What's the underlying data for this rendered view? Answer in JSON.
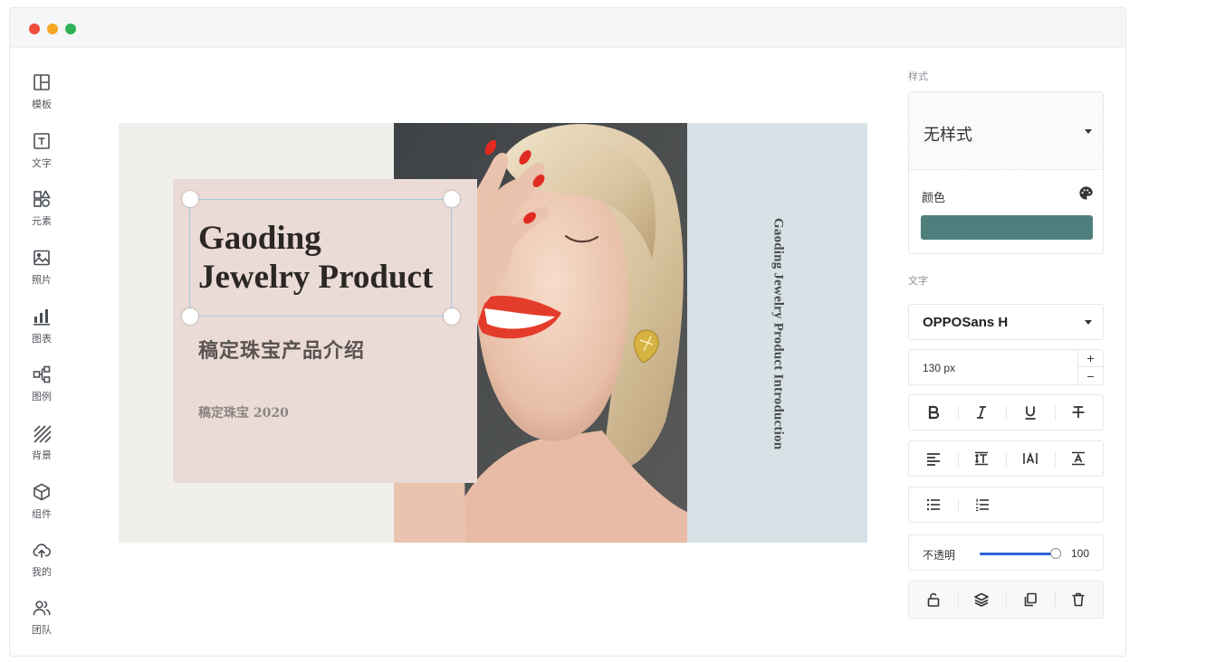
{
  "sidebar": {
    "items": [
      {
        "label": "模板",
        "icon": "layout-icon"
      },
      {
        "label": "文字",
        "icon": "text-icon"
      },
      {
        "label": "元素",
        "icon": "shapes-icon"
      },
      {
        "label": "照片",
        "icon": "image-icon"
      },
      {
        "label": "图表",
        "icon": "bar-chart-icon"
      },
      {
        "label": "图例",
        "icon": "diagram-icon"
      },
      {
        "label": "背景",
        "icon": "stripes-icon"
      },
      {
        "label": "组件",
        "icon": "cube-icon"
      },
      {
        "label": "我的",
        "icon": "cloud-upload-icon"
      },
      {
        "label": "团队",
        "icon": "team-icon"
      }
    ]
  },
  "slide": {
    "title_line1": "Gaoding",
    "title_line2": "Jewelry Product",
    "subtitle": "稿定珠宝产品介绍",
    "caption": "稿定珠宝 2020",
    "vertical_text": "Gaoding Jewelry Product Introduction",
    "colors": {
      "background": "#f0efeb",
      "pink_box": "#eadbd6",
      "blue_panel": "#d7e2e7"
    }
  },
  "panel": {
    "style_label": "样式",
    "style_value": "无样式",
    "color_label": "颜色",
    "color_value": "#4f7f7c",
    "text_label": "文字",
    "font_value": "OPPOSans H",
    "size_value": "130 px",
    "stepper_plus": "+",
    "stepper_minus": "−",
    "opacity_label": "不透明",
    "opacity_value": "100",
    "opacity_fraction": 1.0
  }
}
